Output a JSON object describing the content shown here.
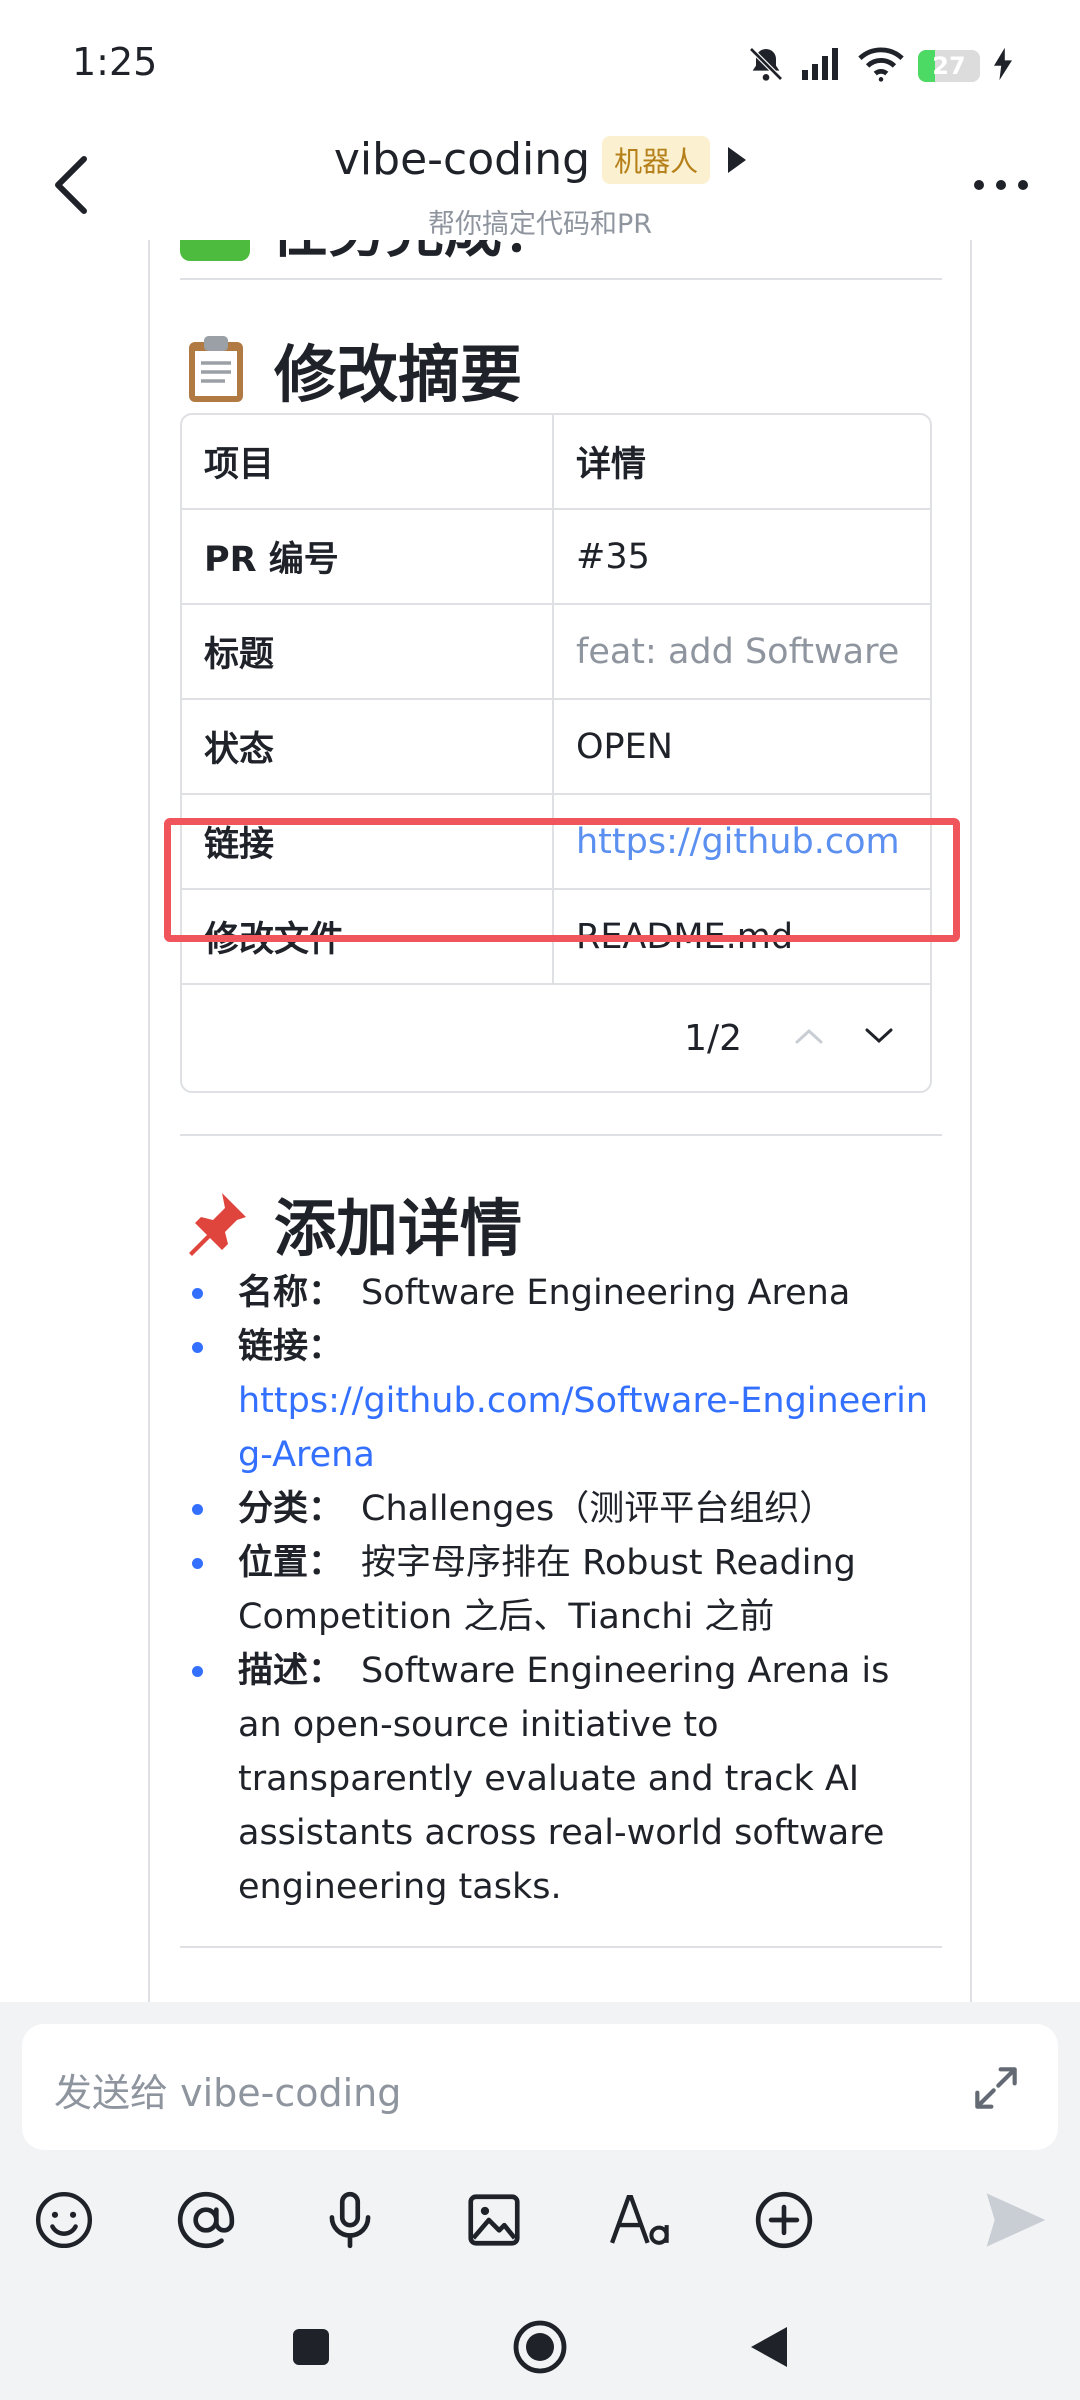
{
  "status_bar": {
    "time": "1:25",
    "battery": "27",
    "battery_level": 0.27
  },
  "header": {
    "title": "vibe-coding",
    "badge": "机器人",
    "subtitle": "帮你搞定代码和PR"
  },
  "message": {
    "partial_heading": "任务完成！",
    "summary_heading": "修改摘要",
    "table": {
      "columns": [
        "项目",
        "详情"
      ],
      "rows": [
        {
          "key": "PR 编号",
          "value": "#35"
        },
        {
          "key": "标题",
          "value": "feat: add Software"
        },
        {
          "key": "状态",
          "value": "OPEN"
        },
        {
          "key": "链接",
          "value": "https://github.com"
        },
        {
          "key": "修改文件",
          "value": "README.md"
        }
      ],
      "pager": "1/2"
    },
    "details_heading": "添加详情",
    "details": [
      {
        "key": "名称：",
        "value": "Software Engineering Arena"
      },
      {
        "key": "链接：",
        "value": "https://github.com/Software-Engineering-Arena"
      },
      {
        "key": "分类：",
        "value": "Challenges（测评平台组织）"
      },
      {
        "key": "位置：",
        "value": "按字母序排在 Robust Reading Competition 之后、Tianchi 之前"
      },
      {
        "key": "描述：",
        "value": "Software Engineering Arena is an open-source initiative to transparently evaluate and track AI assistants across real-world software engineering tasks."
      }
    ]
  },
  "composer": {
    "placeholder": "发送给 vibe-coding"
  },
  "colors": {
    "accent": "#3370ff",
    "highlight": "#f0555b",
    "badge_bg": "#fbf0cf",
    "badge_fg": "#b5801a"
  }
}
